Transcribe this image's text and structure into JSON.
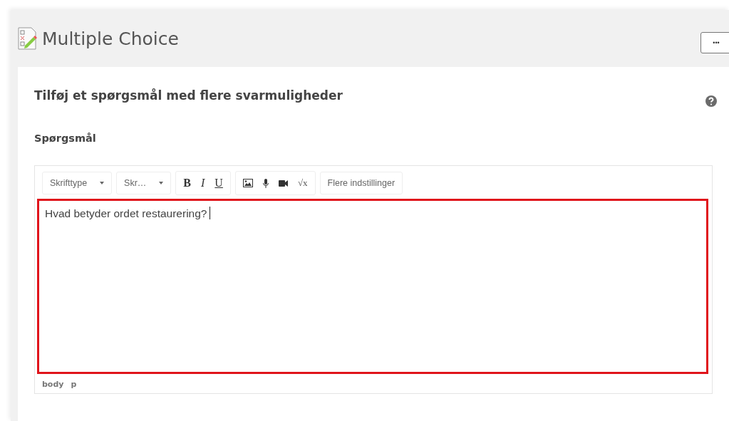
{
  "header": {
    "title": "Multiple Choice",
    "menu_button": "•••"
  },
  "card": {
    "title": "Tilføj et spørgsmål med flere svarmuligheder",
    "section_label": "Spørgsmål"
  },
  "toolbar": [
    {
      "kind": "dropdown",
      "label": "Skrifttype"
    },
    {
      "kind": "dropdown",
      "label": "Skr…"
    },
    {
      "kind": "group",
      "items": [
        {
          "kind": "bold",
          "label": "B"
        },
        {
          "kind": "italic",
          "label": "I"
        },
        {
          "kind": "underline",
          "label": "U"
        }
      ]
    },
    {
      "kind": "group",
      "items": [
        {
          "kind": "image"
        },
        {
          "kind": "mic"
        },
        {
          "kind": "video"
        },
        {
          "kind": "math",
          "label": "√x"
        }
      ]
    },
    {
      "kind": "button",
      "label": "Flere indstillinger"
    }
  ],
  "editor": {
    "value": "Hvad betyder ordet restaurering?",
    "focused": true,
    "highlighted": true
  },
  "status_path": [
    "body",
    "p"
  ]
}
